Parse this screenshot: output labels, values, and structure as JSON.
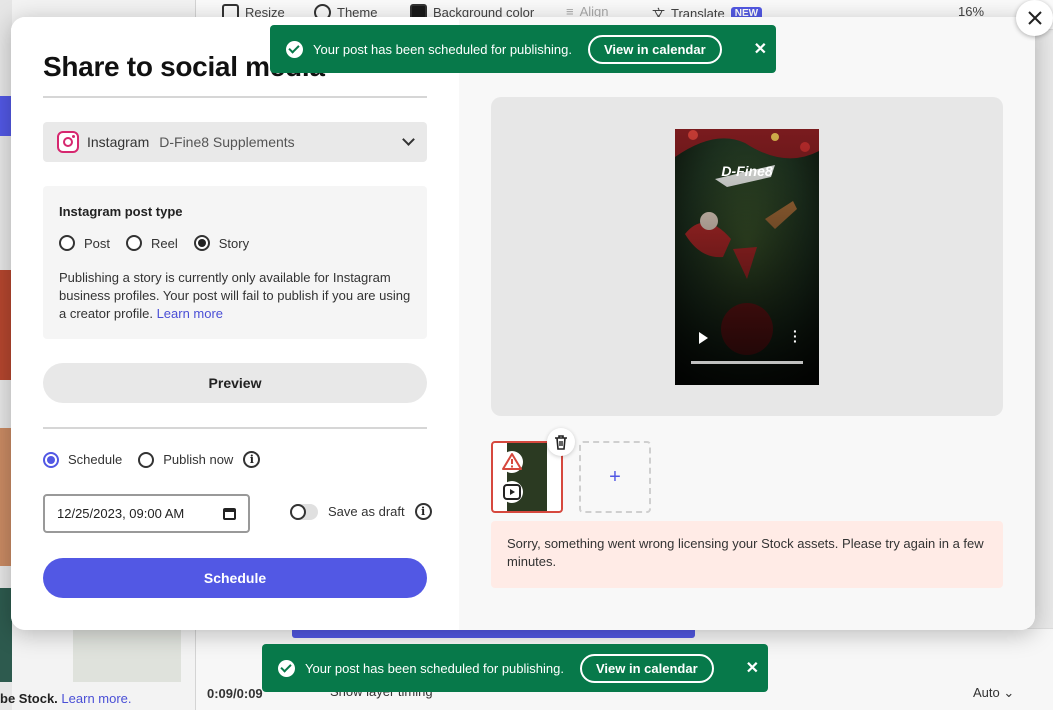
{
  "toolbar": {
    "resize": "Resize",
    "theme": "Theme",
    "background_color": "Background color",
    "align": "Align",
    "translate": "Translate",
    "translate_badge": "NEW",
    "zoom": "16%"
  },
  "timeline": {
    "time": "0:09/0:09",
    "show_layer_timing": "Show layer timing",
    "speed": "Auto"
  },
  "stock_footer": {
    "text": "be Stock.",
    "link": "Learn more."
  },
  "modal": {
    "title": "Share to social media",
    "account": {
      "platform": "Instagram",
      "name": "D-Fine8 Supplements"
    },
    "post_type": {
      "title": "Instagram post type",
      "options": [
        "Post",
        "Reel",
        "Story"
      ],
      "selected": "Story",
      "description": "Publishing a story is currently only available for Instagram business profiles. Your post will fail to publish if you are using a creator profile.",
      "learn_more": "Learn more"
    },
    "preview_button": "Preview",
    "publish_mode": {
      "schedule": "Schedule",
      "publish_now": "Publish now",
      "selected": "Schedule"
    },
    "datetime": "12/25/2023, 09:00 AM",
    "save_as_draft": "Save as draft",
    "schedule_button": "Schedule",
    "story_overlay_text": "D-Fine8",
    "add_slot": "+",
    "error_message": "Sorry, something went wrong licensing your Stock assets. Please try again in a few minutes."
  },
  "toasts": [
    {
      "message": "Your post has been scheduled for publishing.",
      "action": "View in calendar"
    },
    {
      "message": "Your post has been scheduled for publishing.",
      "action": "View in calendar"
    }
  ],
  "colors": {
    "accent": "#5258e4",
    "toast_green": "#07794a",
    "error_bg": "#ffebe6",
    "error_border": "#d6483e",
    "instagram": "#d6276f"
  }
}
